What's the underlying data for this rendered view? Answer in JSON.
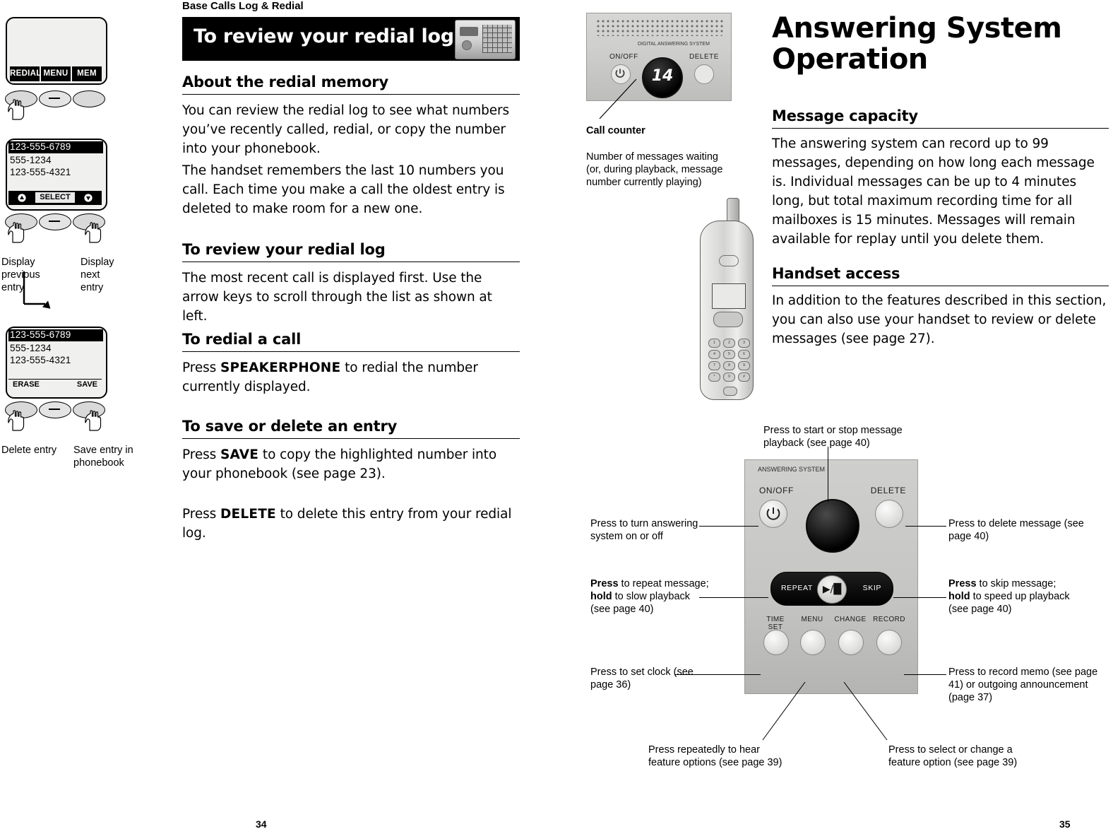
{
  "left_page": {
    "running_head": "Base Calls Log & Redial",
    "title_bar": {
      "title": "To review your redial log"
    },
    "sections": [
      {
        "heading": "About the redial memory",
        "paragraphs": [
          "You can review the redial log to see what numbers you’ve recently called, redial, or copy the number into your phonebook.",
          "The handset remembers the last 10 numbers you call. Each time you make a call the oldest entry is deleted to make room for a new one."
        ]
      },
      {
        "heading": "To review your redial log",
        "paragraphs": [
          "The most recent call is displayed first. Use the arrow keys to scroll through the list as shown at left."
        ]
      },
      {
        "heading": "To redial a call",
        "paragraphs": []
      },
      {
        "heading": "To save or delete an entry",
        "paragraphs": []
      }
    ],
    "redial_paragraph": {
      "pre": "Press ",
      "bold": "SPEAKERPHONE",
      "post": " to redial the number currently displayed."
    },
    "save_paragraph": {
      "pre": "Press ",
      "bold": "SAVE",
      "post": " to copy the highlighted number into your phonebook (see page 23)."
    },
    "delete_paragraph": {
      "pre": "Press ",
      "bold": "DELETE",
      "post": " to delete this entry from your redial log."
    },
    "device_top": {
      "softkeys": [
        "REDIAL",
        "MENU",
        "MEM"
      ]
    },
    "device_mid": {
      "lines": [
        "123-555-6789",
        "555-1234",
        "123-555-4321"
      ],
      "select_label": "SELECT",
      "left_caption": "Display previous entry",
      "right_caption": "Display next entry"
    },
    "device_bottom": {
      "lines": [
        "123-555-6789",
        "555-1234",
        "123-555-4321"
      ],
      "left_softkey": "ERASE",
      "right_softkey": "SAVE",
      "left_caption": "Delete entry",
      "right_caption": "Save entry in phonebook"
    },
    "page_number": "34"
  },
  "right_page": {
    "title": "Answering System Operation",
    "sections": [
      {
        "heading": "Message capacity",
        "paragraphs": [
          "The answering system can record up to 99 messages, depending on how long each message is. Individual messages can be up to 4 minutes long, but total maximum recording time for all mailboxes is 15 minutes. Messages will remain available for replay until you delete them."
        ]
      },
      {
        "heading": "Handset access",
        "paragraphs": [
          "In addition to the features described in this section, you can also use your handset to review or delete messages (see page 27)."
        ]
      }
    ],
    "call_counter": {
      "label": "Call counter",
      "description": "Number of messages waiting (or, during playback, message number currently playing)",
      "display_value": "14",
      "onoff_label": "ON/OFF",
      "delete_label": "DELETE",
      "brand_label": "DIGITAL ANSWERING SYSTEM"
    },
    "base_diagram": {
      "brand_label": "ANSWERING SYSTEM",
      "onoff_label": "ON/OFF",
      "delete_label": "DELETE",
      "repeat_label": "REPEAT",
      "skip_label": "SKIP",
      "play_glyph": "▶/█",
      "bottom_labels": [
        "TIME SET",
        "MENU",
        "CHANGE",
        "RECORD"
      ],
      "callouts": {
        "play_stop": "Press to start or stop message playback (see page 40)",
        "turn_on_off": "Press to turn answering system on or off",
        "delete_message": "Press to delete message (see page 40)",
        "repeat_bold": "Press",
        "repeat_rest": " to repeat message;",
        "repeat_hold_bold": "hold",
        "repeat_hold_rest": " to slow playback",
        "repeat_page": "(see page 40)",
        "skip_bold": "Press",
        "skip_rest": " to skip message;",
        "skip_hold_bold": "hold",
        "skip_hold_rest": " to speed up playback",
        "skip_page": "(see page 40)",
        "set_clock": "Press to set clock (see page 36)",
        "record_memo": "Press to record memo (see page 41) or outgoing announcement (page 37)",
        "feature_options": "Press repeatedly to hear feature options (see page 39)",
        "select_change": "Press to select or change a feature option (see page 39)"
      }
    },
    "page_number": "35"
  }
}
